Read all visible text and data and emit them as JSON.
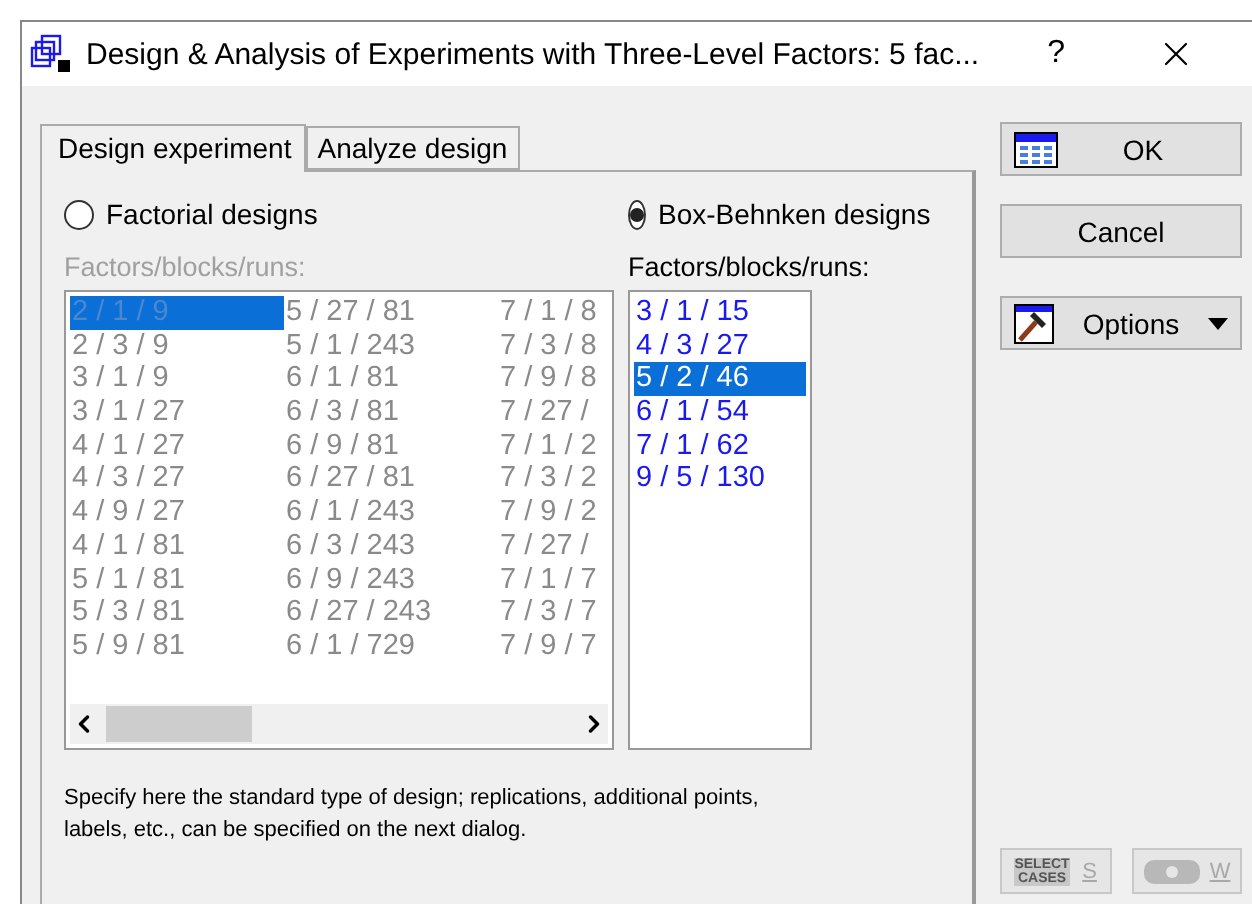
{
  "window": {
    "title": "Design & Analysis of Experiments with Three-Level Factors: 5 fac...",
    "help": "?"
  },
  "tabs": [
    {
      "label": "Design experiment",
      "selected": true
    },
    {
      "label": "Analyze design",
      "selected": false
    }
  ],
  "design_types": [
    {
      "label": "Factorial designs",
      "selected": false,
      "list_label": "Factors/blocks/runs:",
      "items": [
        {
          "text": "2 / 1 / 9",
          "selected": true
        },
        {
          "text": "2 / 3 / 9",
          "selected": false
        },
        {
          "text": "3 / 1 / 9",
          "selected": false
        },
        {
          "text": "3 / 1 / 27",
          "selected": false
        },
        {
          "text": "4 / 1 / 27",
          "selected": false
        },
        {
          "text": "4 / 3 / 27",
          "selected": false
        },
        {
          "text": "4 / 9 / 27",
          "selected": false
        },
        {
          "text": "4 / 1 / 81",
          "selected": false
        },
        {
          "text": "5 / 1 / 81",
          "selected": false
        },
        {
          "text": "5 / 3 / 81",
          "selected": false
        },
        {
          "text": "5 / 9 / 81",
          "selected": false
        },
        {
          "text": "5 / 27 / 81",
          "selected": false
        },
        {
          "text": "5 / 1 / 243",
          "selected": false
        },
        {
          "text": "6 / 1 / 81",
          "selected": false
        },
        {
          "text": "6 / 3 / 81",
          "selected": false
        },
        {
          "text": "6 / 9 / 81",
          "selected": false
        },
        {
          "text": "6 / 27 / 81",
          "selected": false
        },
        {
          "text": "6 / 1 / 243",
          "selected": false
        },
        {
          "text": "6 / 3 / 243",
          "selected": false
        },
        {
          "text": "6 / 9 / 243",
          "selected": false
        },
        {
          "text": "6 / 27 / 243",
          "selected": false
        },
        {
          "text": "6 / 1 / 729",
          "selected": false
        },
        {
          "text": "7 / 1 / 8",
          "selected": false
        },
        {
          "text": "7 / 3 / 8",
          "selected": false
        },
        {
          "text": "7 / 9 / 8",
          "selected": false
        },
        {
          "text": "7 / 27 /",
          "selected": false
        },
        {
          "text": "7 / 1 / 2",
          "selected": false
        },
        {
          "text": "7 / 3 / 2",
          "selected": false
        },
        {
          "text": "7 / 9 / 2",
          "selected": false
        },
        {
          "text": "7 / 27 /",
          "selected": false
        },
        {
          "text": "7 / 1 / 7",
          "selected": false
        },
        {
          "text": "7 / 3 / 7",
          "selected": false
        },
        {
          "text": "7 / 9 / 7",
          "selected": false
        }
      ]
    },
    {
      "label": "Box-Behnken designs",
      "selected": true,
      "list_label": "Factors/blocks/runs:",
      "items": [
        {
          "text": "3 / 1 / 15",
          "selected": false
        },
        {
          "text": "4 / 3 / 27",
          "selected": false
        },
        {
          "text": "5 / 2 / 46",
          "selected": true
        },
        {
          "text": "6 / 1 / 54",
          "selected": false
        },
        {
          "text": "7 / 1 / 62",
          "selected": false
        },
        {
          "text": "9 / 5 / 130",
          "selected": false
        }
      ]
    }
  ],
  "hint": "Specify here the standard type of design; replications, additional points, labels, etc., can be specified on the next dialog.",
  "buttons": [
    {
      "kind": "ok",
      "label": "OK"
    },
    {
      "kind": "cancel",
      "label": "Cancel"
    },
    {
      "kind": "options",
      "label": "Options"
    }
  ],
  "tool_buttons": [
    {
      "kind": "select_cases",
      "icon_text": "SELECT CASES",
      "key": "S",
      "disabled": true
    },
    {
      "kind": "weight",
      "key": "W",
      "disabled": true
    }
  ]
}
